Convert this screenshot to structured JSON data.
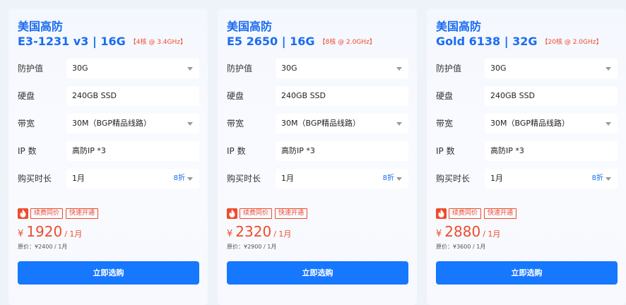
{
  "labels": {
    "defense": "防护值",
    "disk": "硬盘",
    "bandwidth": "带宽",
    "ip": "IP 数",
    "duration": "购买时长"
  },
  "badges": {
    "renew": "续费同价",
    "fast": "快速开通"
  },
  "buy_label": "立即选购",
  "cards": [
    {
      "title": "美国高防",
      "subtitle": "E3-1231 v3 | 16G",
      "tag": "【4核 @ 3.4GHz】",
      "defense": "30G",
      "disk": "240GB SSD",
      "bandwidth": "30M（BGP精品线路）",
      "ip": "高防IP *3",
      "duration": "1月",
      "discount": "8折",
      "currency": "¥",
      "price": "1920",
      "per": "/ 1月",
      "original": "原价：¥2400 / 1月"
    },
    {
      "title": "美国高防",
      "subtitle": "E5 2650 | 16G",
      "tag": "【8核 @ 2.0GHz】",
      "defense": "30G",
      "disk": "240GB SSD",
      "bandwidth": "30M（BGP精品线路）",
      "ip": "高防IP *3",
      "duration": "1月",
      "discount": "8折",
      "currency": "¥",
      "price": "2320",
      "per": "/ 1月",
      "original": "原价：¥2900 / 1月"
    },
    {
      "title": "美国高防",
      "subtitle": "Gold 6138 | 32G",
      "tag": "【20核 @ 2.0GHz】",
      "defense": "30G",
      "disk": "240GB SSD",
      "bandwidth": "30M（BGP精品线路）",
      "ip": "高防IP *3",
      "duration": "1月",
      "discount": "8折",
      "currency": "¥",
      "price": "2880",
      "per": "/ 1月",
      "original": "原价：¥3600 / 1月"
    }
  ],
  "colors": {
    "accent": "#1a6cf0",
    "price": "#f04b2d",
    "button": "#1677ff"
  }
}
